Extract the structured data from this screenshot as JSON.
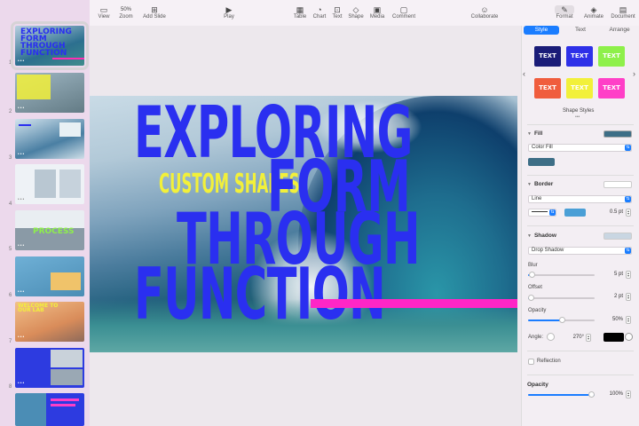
{
  "toolbar": {
    "view": "View",
    "zoom_value": "50%",
    "zoom": "Zoom",
    "add_slide": "Add Slide",
    "play": "Play",
    "table": "Table",
    "chart": "Chart",
    "text": "Text",
    "shape": "Shape",
    "media": "Media",
    "comment": "Comment",
    "collaborate": "Collaborate",
    "format": "Format",
    "animate": "Animate",
    "document": "Document"
  },
  "navigator": {
    "slide_numbers": [
      "1",
      "2",
      "3",
      "4",
      "5",
      "6",
      "7",
      "8",
      "9"
    ],
    "thumb1_text": "EXPLORING FORM THROUGH FUNCTION",
    "thumb5_text": "PROCESS",
    "thumb7_text": "WELCOME TO OUR LAB"
  },
  "slide": {
    "line1": "EXPLORING",
    "line2": "FORM",
    "line3": "THROUGH",
    "line4": "FUNCTION",
    "subtitle": "CUSTOM SHAPES"
  },
  "inspector": {
    "tabs": [
      "Style",
      "Text",
      "Arrange"
    ],
    "swatch_label": "TEXT",
    "swatch_colors": [
      "#1a1c78",
      "#2e30e8",
      "#8ef04a",
      "#f05d3d",
      "#f2f03a",
      "#ff3fc7"
    ],
    "swatch_text_colors": [
      "#ffffff",
      "#ffffff",
      "#ffffff",
      "#ffffff",
      "#ffffff",
      "#ffffff"
    ],
    "shape_styles_label": "Shape Styles",
    "fill_label": "Fill",
    "fill_type": "Color Fill",
    "fill_color": "#3d6e86",
    "border_label": "Border",
    "border_type": "Line",
    "border_color": "#4a9fd6",
    "border_width": "0.5 pt",
    "shadow_label": "Shadow",
    "shadow_type": "Drop Shadow",
    "blur_label": "Blur",
    "blur_value": "5 pt",
    "blur_fraction": 0.05,
    "offset_label": "Offset",
    "offset_value": "2 pt",
    "offset_fraction": 0.02,
    "opacity_label": "Opacity",
    "shadow_opacity_value": "50%",
    "shadow_opacity_fraction": 0.5,
    "angle_label": "Angle:",
    "angle_value": "270°",
    "shadow_color": "#000000",
    "reflection_label": "Reflection",
    "opacity_section_label": "Opacity",
    "opacity_value": "100%",
    "opacity_fraction": 1.0
  },
  "colors": {
    "accent": "#1a7dff",
    "headline_blue": "#2a2ff0",
    "headline_yellow": "#f2f03a",
    "pink_bar": "#ff26c6"
  }
}
